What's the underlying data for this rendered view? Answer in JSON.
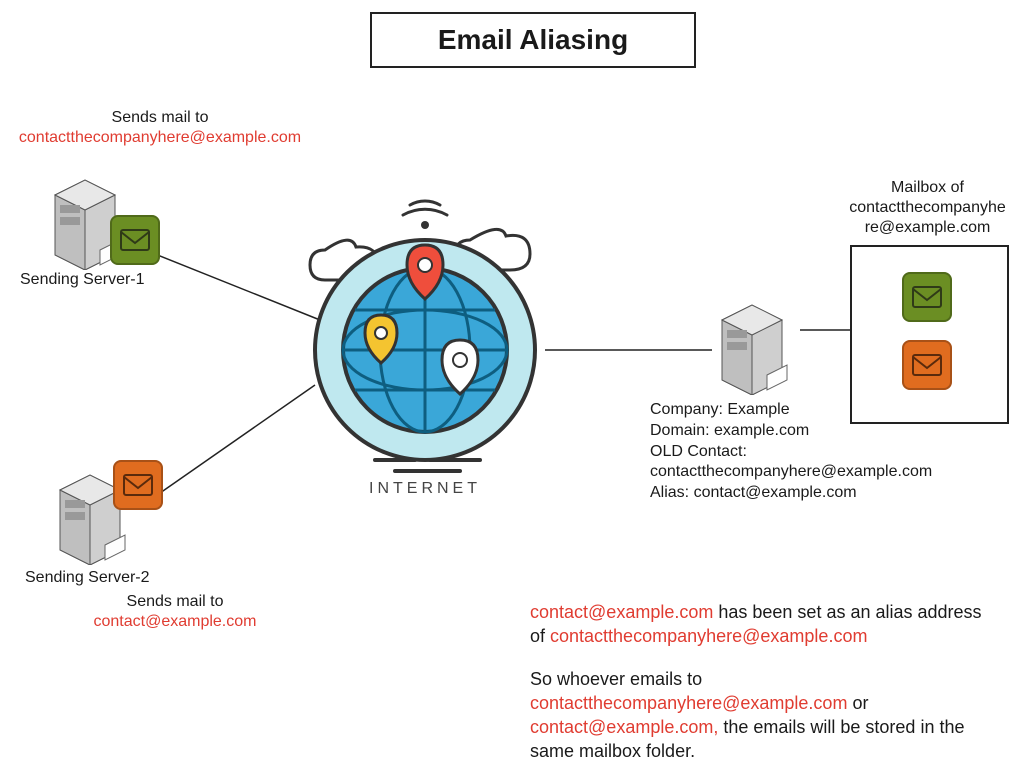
{
  "title": "Email Aliasing",
  "server1": {
    "caption_line1": "Sends mail to",
    "caption_email": "contactthecompanyhere@example.com",
    "label": "Sending Server-1"
  },
  "server2": {
    "caption_line1": "Sends mail to",
    "caption_email": "contact@example.com",
    "label": "Sending Server-2"
  },
  "internet_label": "INTERNET",
  "company_info": {
    "l1": "Company: Example",
    "l2": "Domain: example.com",
    "l3": "OLD Contact:",
    "l4": "contactthecompanyhere@example.com",
    "l5": "Alias: contact@example.com"
  },
  "mailbox_caption_l1": "Mailbox of",
  "mailbox_caption_l2": "contactthecompanyhe",
  "mailbox_caption_l3": "re@example.com",
  "explain": {
    "p1a": "contact@example.com",
    "p1b": " has been set as an alias address of ",
    "p1c": "contactthecompanyhere@example.com",
    "p2a": "So whoever emails to ",
    "p2b": "contactthecompanyhere@example.com",
    "p2c": " or ",
    "p2d": "contact@example.com,",
    "p2e": " the emails will be stored in the same mailbox folder."
  },
  "colors": {
    "accent_red": "#e03c31"
  }
}
